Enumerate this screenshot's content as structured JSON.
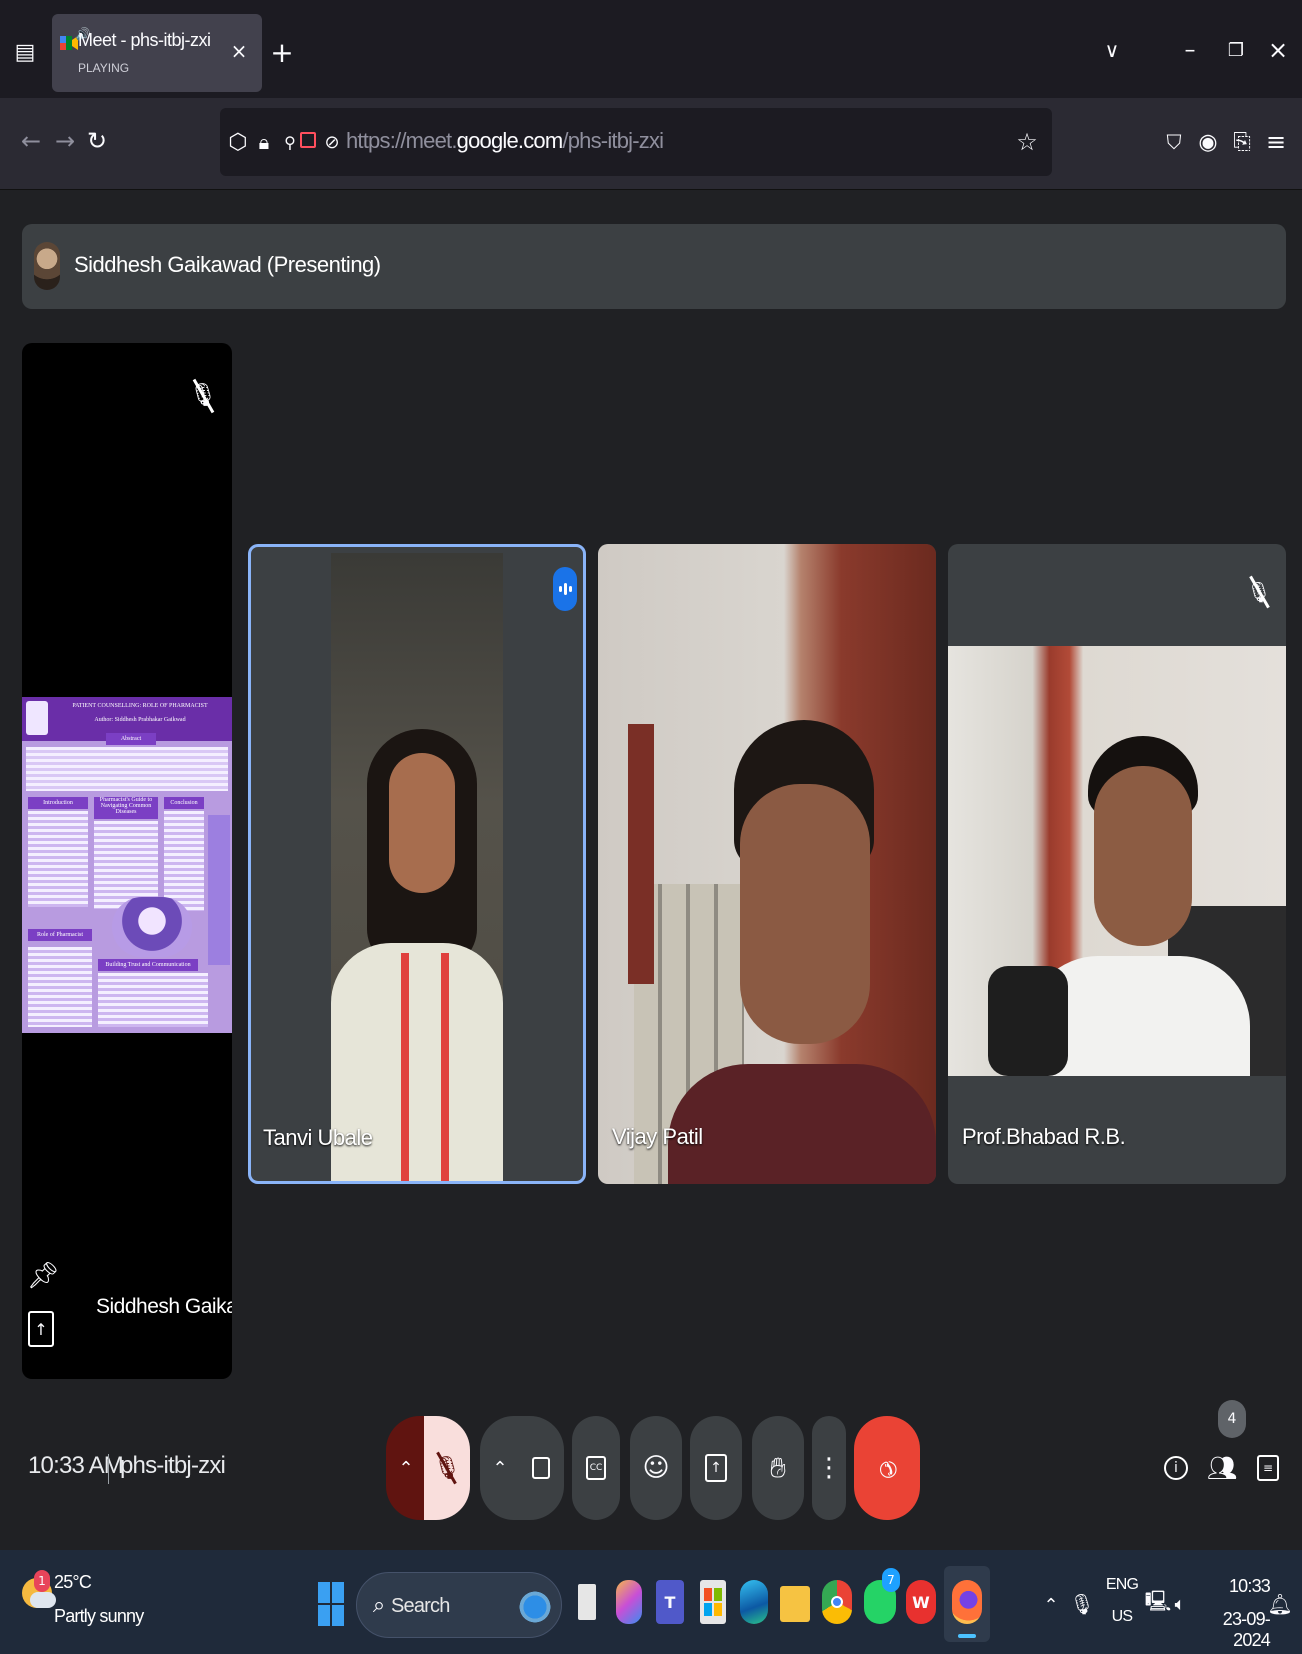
{
  "browser": {
    "tab_title": "Meet - phs-itbj-zxi",
    "tab_status": "PLAYING",
    "new_tab_icon": "plus-icon",
    "url_prefix": "https://meet.",
    "url_domain": "google.com",
    "url_path": "/phs-itbj-zxi"
  },
  "meet": {
    "presenter_label": "Siddhesh Gaikawad (Presenting)",
    "presenter_tile_name": "Siddhesh Gaikaw...",
    "poster": {
      "title_line1": "PATIENT COUNSELLING: ROLE OF PHARMACIST",
      "title_line2": "Author: Siddhesh Prabhakar Gaikwad",
      "abstract": "Abstract",
      "intro": "Introduction",
      "guidance": "Pharmacist's Guide to Navigating Common Diseases",
      "conclusion": "Conclusion",
      "role": "Role of Pharmacist",
      "trust": "Building Trust and Communication"
    },
    "participants": [
      {
        "name": "Tanvi Ubale",
        "speaking": true
      },
      {
        "name": "Vijay Patil",
        "speaking": false
      },
      {
        "name": "Prof.Bhabad R.B.",
        "speaking": false,
        "muted": true
      }
    ],
    "time": "10:33 AM",
    "meeting_code": "phs-itbj-zxi",
    "people_count": "4"
  },
  "taskbar": {
    "temperature": "25°C",
    "weather": "Partly sunny",
    "weather_badge": "1",
    "search_placeholder": "Search",
    "whatsapp_badge": "7",
    "lang_top": "ENG",
    "lang_bottom": "US",
    "clock_time": "10:33",
    "clock_date": "23-09-2024"
  },
  "colors": {
    "accent_blue": "#1a73e8",
    "end_call_red": "#ea4335",
    "mic_off_bg": "#f9dedc",
    "mic_off_dark": "#601410"
  }
}
